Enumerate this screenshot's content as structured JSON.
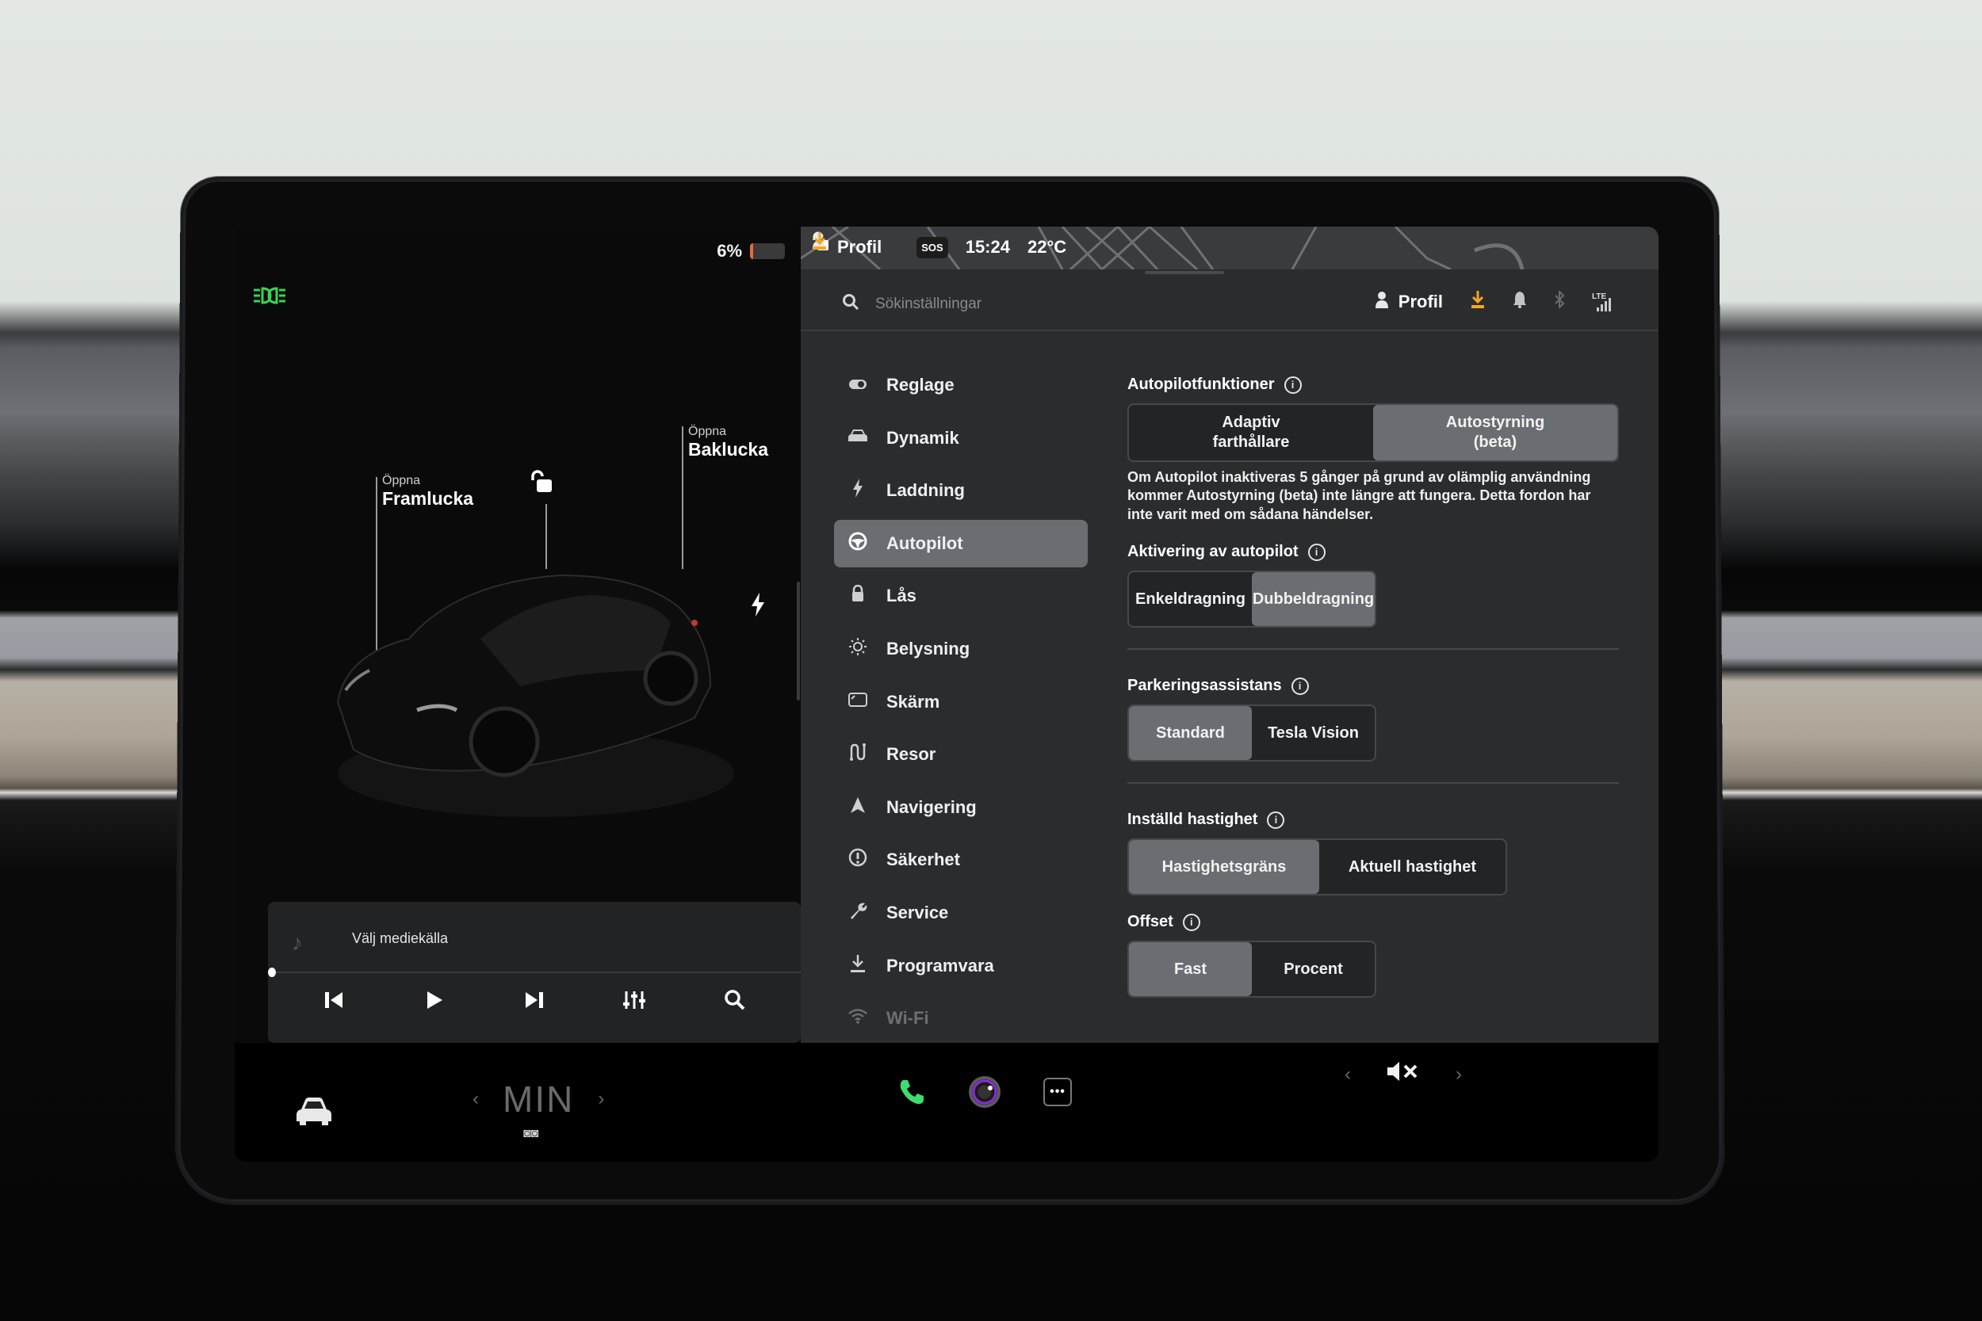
{
  "car_panel": {
    "battery_percent_label": "6%",
    "battery_level": 0.06,
    "battery_color": "#e8673b",
    "headlight_indicator_color": "#39d353",
    "frunk": {
      "action": "Öppna",
      "label": "Framlucka"
    },
    "trunk": {
      "action": "Öppna",
      "label": "Baklucka"
    },
    "lock_icon": "unlocked-padlock-icon",
    "charge_port_icon": "lightning-icon"
  },
  "media": {
    "source_prompt": "Välj mediekälla",
    "progress": 0.0,
    "controls": [
      "previous-track",
      "play",
      "next-track",
      "equalizer",
      "search"
    ]
  },
  "status_bar": {
    "profile_label": "Profil",
    "sos_label": "SOS",
    "time": "15:24",
    "temperature": "22°C",
    "accent_color": "#f5a623"
  },
  "settings_header": {
    "search_placeholder": "Sökinställningar",
    "profile_label": "Profil",
    "network_label": "LTE"
  },
  "sidebar": {
    "active": "Autopilot",
    "items": [
      {
        "label": "Reglage",
        "icon": "toggle-icon"
      },
      {
        "label": "Dynamik",
        "icon": "car-icon"
      },
      {
        "label": "Laddning",
        "icon": "lightning-icon"
      },
      {
        "label": "Autopilot",
        "icon": "steering-wheel-icon"
      },
      {
        "label": "Lås",
        "icon": "padlock-icon"
      },
      {
        "label": "Belysning",
        "icon": "sun-icon"
      },
      {
        "label": "Skärm",
        "icon": "display-icon"
      },
      {
        "label": "Resor",
        "icon": "route-icon"
      },
      {
        "label": "Navigering",
        "icon": "navigation-arrow-icon"
      },
      {
        "label": "Säkerhet",
        "icon": "alert-circle-icon"
      },
      {
        "label": "Service",
        "icon": "wrench-icon"
      },
      {
        "label": "Programvara",
        "icon": "download-icon"
      },
      {
        "label": "Wi-Fi",
        "icon": "wifi-icon"
      }
    ]
  },
  "autopilot": {
    "features": {
      "title": "Autopilotfunktioner",
      "options": [
        "Adaptiv farthållare",
        "Autostyrning (beta)"
      ],
      "option_lines": [
        [
          "Adaptiv",
          "farthållare"
        ],
        [
          "Autostyrning",
          "(beta)"
        ]
      ],
      "selected": "Autostyrning (beta)",
      "description": "Om Autopilot inaktiveras 5 gånger på grund av olämplig användning kommer Autostyrning (beta) inte längre att fungera. Detta fordon har inte varit med om sådana händelser."
    },
    "activation": {
      "title": "Aktivering av autopilot",
      "options": [
        "Enkeldragning",
        "Dubbeldragning"
      ],
      "selected": "Dubbeldragning"
    },
    "parking_assist": {
      "title": "Parkeringsassistans",
      "options": [
        "Standard",
        "Tesla Vision"
      ],
      "selected": "Standard"
    },
    "set_speed": {
      "title": "Inställd hastighet",
      "options": [
        "Hastighetsgräns",
        "Aktuell hastighet"
      ],
      "selected": "Hastighetsgräns"
    },
    "offset": {
      "title": "Offset",
      "options": [
        "Fast",
        "Procent"
      ],
      "selected": "Fast"
    }
  },
  "dock": {
    "climate_temp": "MIN",
    "apps": [
      "phone",
      "camera",
      "more"
    ],
    "volume_state": "muted",
    "phone_color": "#3ddc6f",
    "camera_ring_color": "#8a2be2"
  }
}
